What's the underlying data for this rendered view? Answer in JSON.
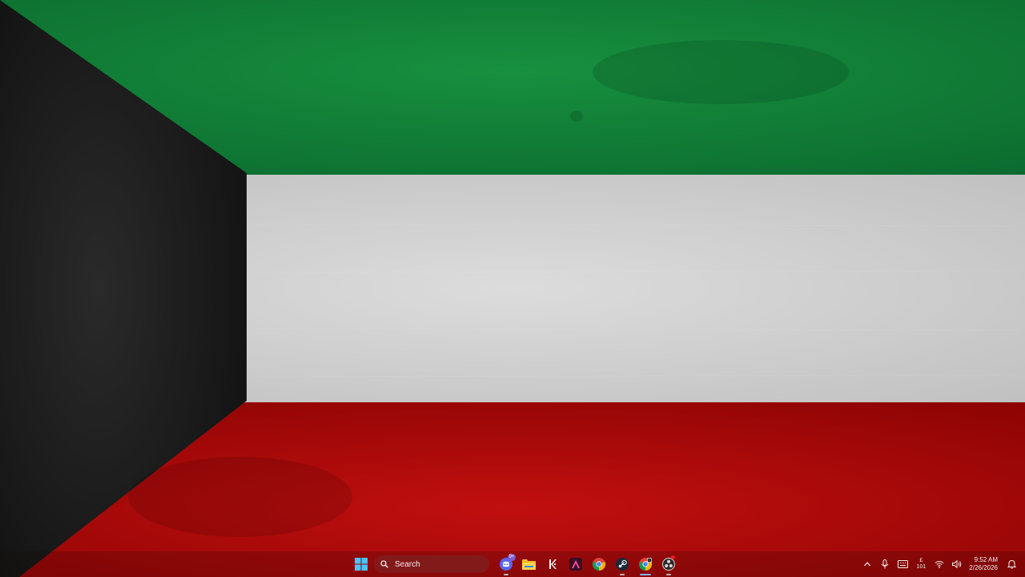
{
  "wallpaper": {
    "description_colors": {
      "green": "#11803a",
      "white": "#d9d9d9",
      "red": "#b50a0a",
      "black": "#1b1b1b"
    }
  },
  "taskbar": {
    "start_icon": "windows-logo-icon",
    "search": {
      "placeholder": "Search",
      "icon": "search-icon"
    },
    "apps": [
      {
        "name": "discord",
        "icon": "discord-icon",
        "badge": "9+"
      },
      {
        "name": "file-explorer",
        "icon": "folder-icon"
      },
      {
        "name": "app-k",
        "icon": "k-app-icon"
      },
      {
        "name": "affinity",
        "icon": "affinity-icon"
      },
      {
        "name": "chrome",
        "icon": "chrome-icon"
      },
      {
        "name": "steam",
        "icon": "steam-icon"
      },
      {
        "name": "chrome-profile",
        "icon": "chrome-profile-icon"
      },
      {
        "name": "obs",
        "icon": "obs-icon"
      }
    ],
    "tray": {
      "chevron_icon": "chevron-up-icon",
      "mic_icon": "microphone-icon",
      "keyboard_icon": "keyboard-icon",
      "ime_top": "£",
      "ime_bottom": "101",
      "wifi_icon": "wifi-icon",
      "volume_icon": "volume-icon",
      "time": "9:52 AM",
      "date": "2/26/2026",
      "notification_icon": "notification-bell-icon"
    }
  }
}
